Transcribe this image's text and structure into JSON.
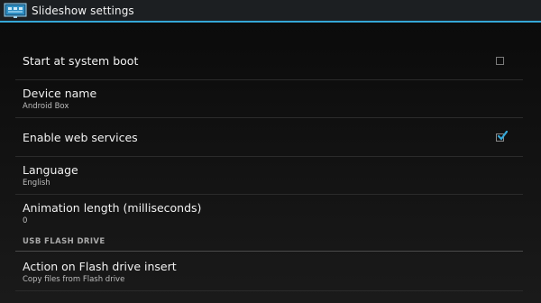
{
  "actionbar": {
    "title": "Slideshow settings",
    "icon": "slideshow-app-icon"
  },
  "preferences": [
    {
      "title": "Start at system boot",
      "checked": false
    },
    {
      "title": "Device name",
      "summary": "Android Box"
    },
    {
      "title": "Enable web services",
      "checked": true
    },
    {
      "title": "Language",
      "summary": "English"
    },
    {
      "title": "Animation length (milliseconds)",
      "summary": "0"
    }
  ],
  "category_usb": "USB FLASH DRIVE",
  "flash_action": {
    "title": "Action on Flash drive insert",
    "summary": "Copy files from Flash drive"
  },
  "colors": {
    "accent": "#35a7d7",
    "background": "#101010",
    "actionbar": "#1c1f22"
  }
}
